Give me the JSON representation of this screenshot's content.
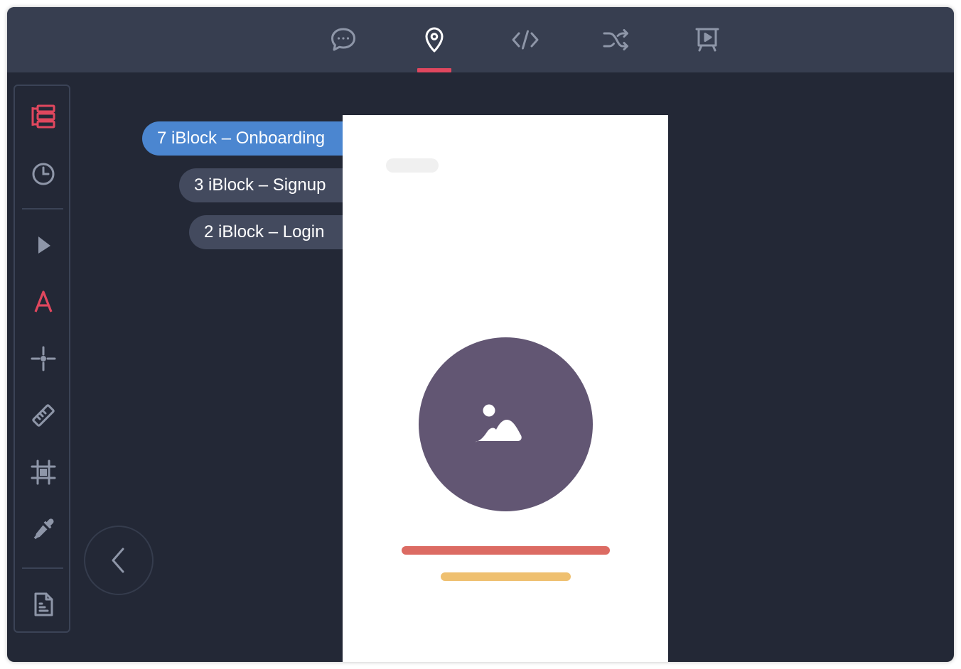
{
  "colors": {
    "accent": "#e0475e",
    "active_pill": "#4b86d0",
    "inactive_pill": "#434a5e",
    "avatar": "#625673",
    "bar_red": "#dc6b63",
    "bar_yellow": "#efc070"
  },
  "topbar": {
    "tabs": [
      {
        "icon": "chat-bubble-icon",
        "active": false
      },
      {
        "icon": "map-pin-icon",
        "active": true
      },
      {
        "icon": "code-icon",
        "active": false
      },
      {
        "icon": "shuffle-icon",
        "active": false
      },
      {
        "icon": "presentation-icon",
        "active": false
      }
    ]
  },
  "toolbar": {
    "tools": [
      {
        "icon": "layers-tree-icon",
        "active": true
      },
      {
        "icon": "clock-history-icon",
        "active": false
      },
      {
        "icon": "cursor-arrow-icon",
        "active": false
      },
      {
        "icon": "text-a-icon",
        "active": true
      },
      {
        "icon": "crosshair-icon",
        "active": false
      },
      {
        "icon": "ruler-icon",
        "active": false
      },
      {
        "icon": "artboard-frame-icon",
        "active": false
      },
      {
        "icon": "eyedropper-icon",
        "active": false
      },
      {
        "icon": "document-icon",
        "active": false
      }
    ]
  },
  "screens": [
    {
      "label": "7 iBlock – Onboarding",
      "active": true
    },
    {
      "label": "3 iBlock – Signup",
      "active": false
    },
    {
      "label": "2 iBlock – Login",
      "active": false
    }
  ],
  "back_button": {
    "icon": "chevron-left-icon"
  }
}
